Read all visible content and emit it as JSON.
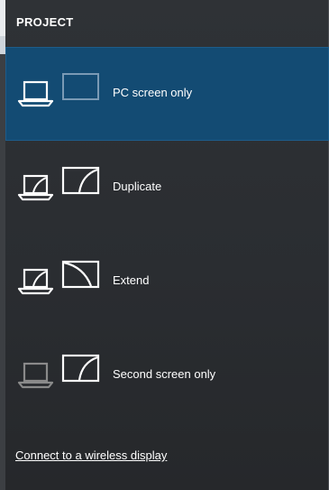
{
  "panel": {
    "title": "PROJECT",
    "options": [
      {
        "label": "PC screen only",
        "icon": "pc-screen-only-icon",
        "selected": true
      },
      {
        "label": "Duplicate",
        "icon": "duplicate-icon",
        "selected": false
      },
      {
        "label": "Extend",
        "icon": "extend-icon",
        "selected": false
      },
      {
        "label": "Second screen only",
        "icon": "second-screen-only-icon",
        "selected": false
      }
    ],
    "connect_link": "Connect to a wireless display"
  },
  "colors": {
    "selected_background": "#134b73",
    "panel_background": "#2a2d31",
    "icon_active": "#ffffff",
    "icon_dimmed": "#8a8a8a",
    "second_screen_dim": "#7a9ab5"
  }
}
